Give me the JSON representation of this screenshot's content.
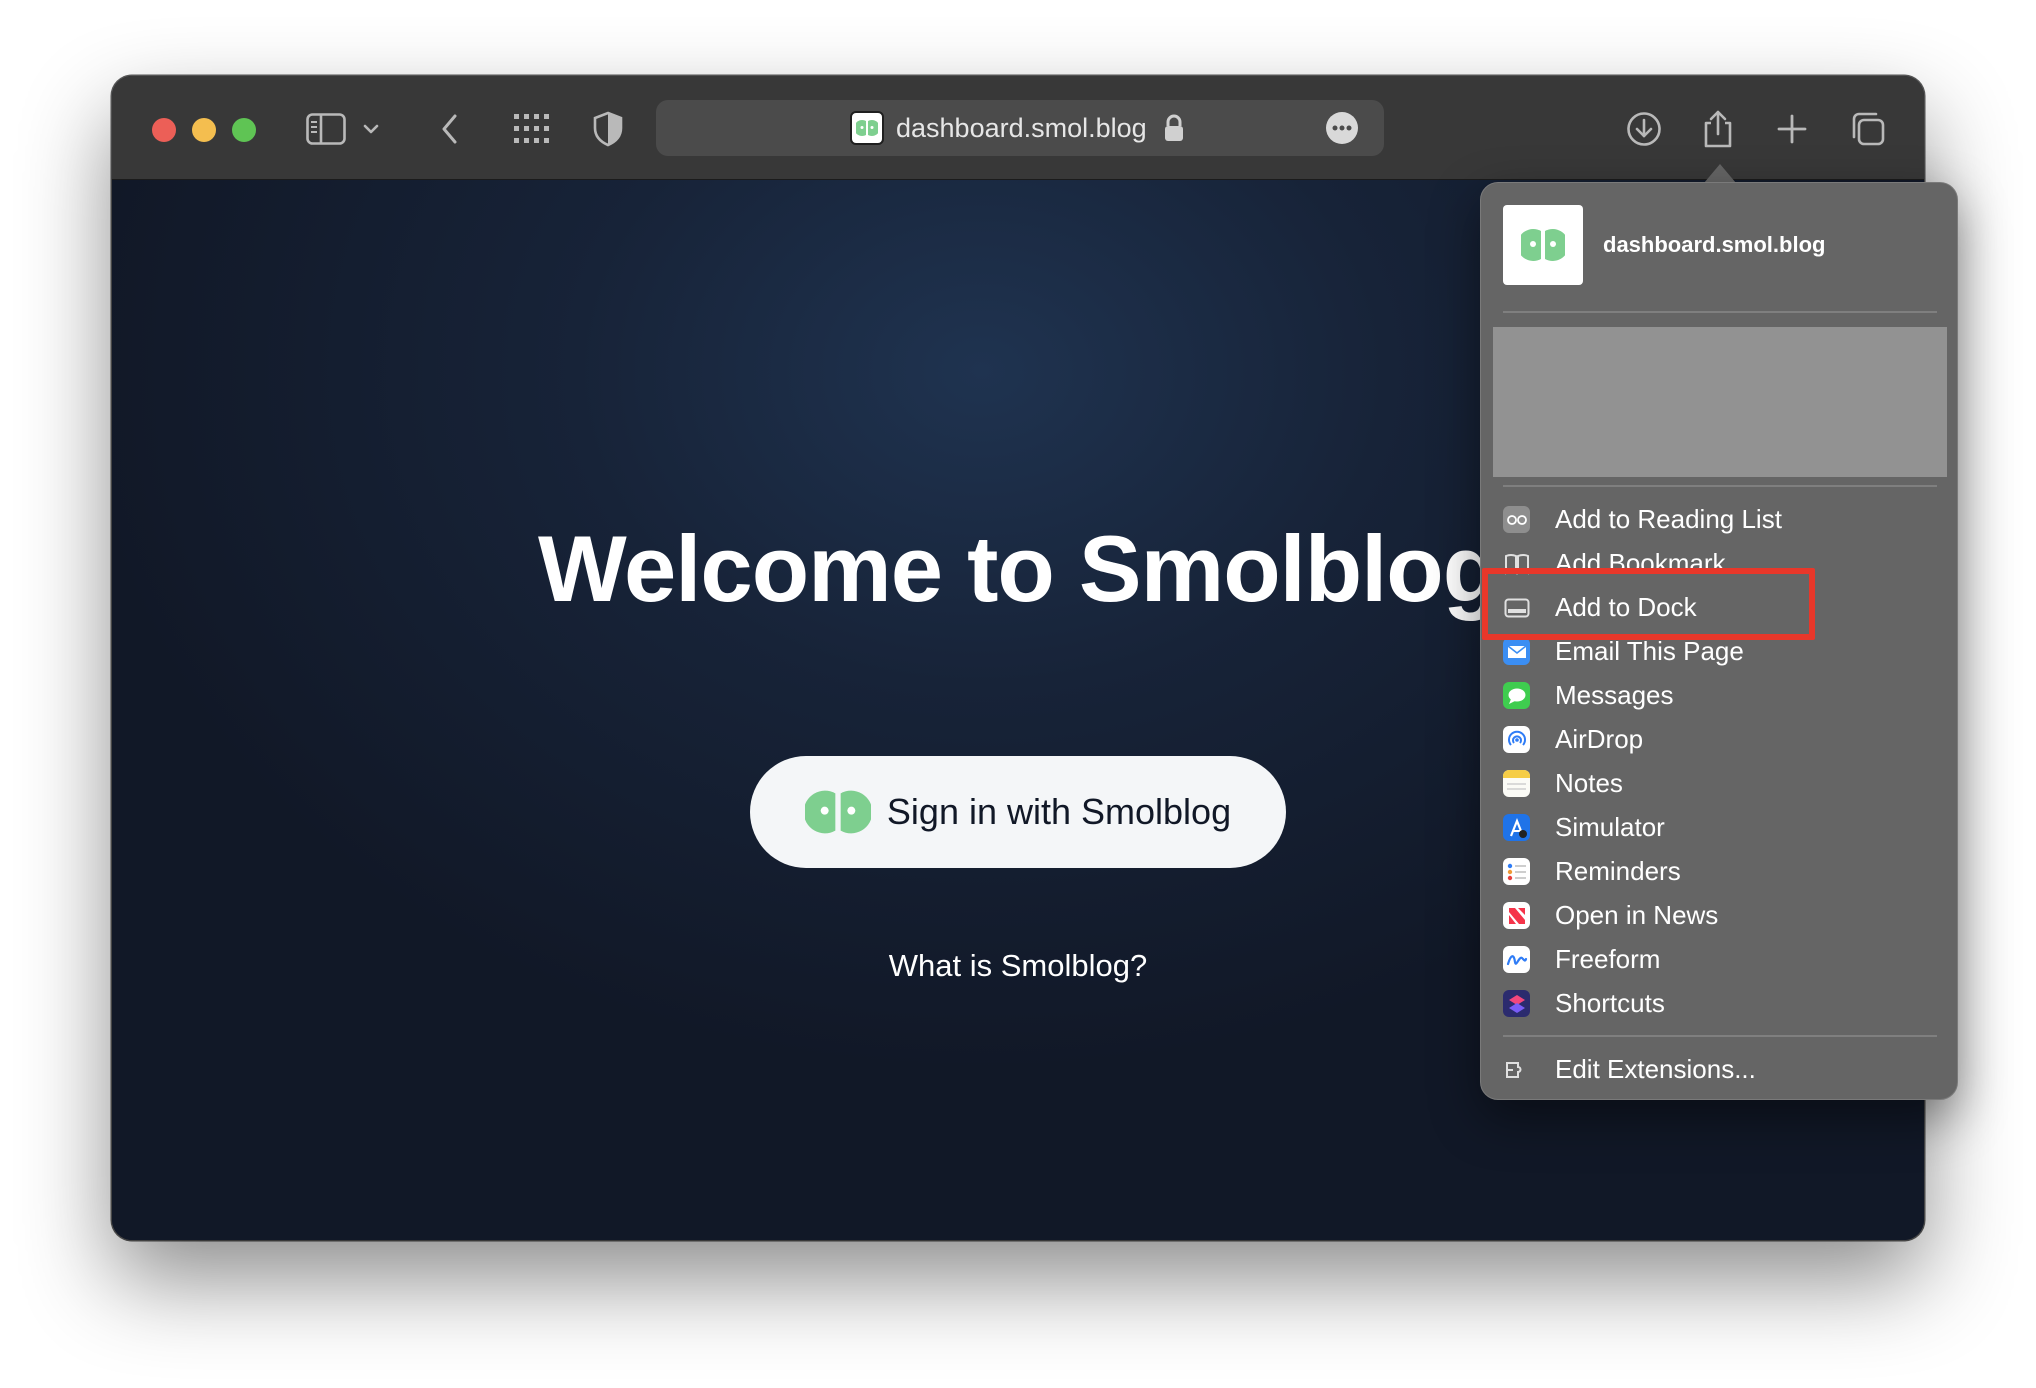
{
  "browser": {
    "url": "dashboard.smol.blog",
    "colors": {
      "close": "#ec5f57",
      "minimize": "#f4be4f",
      "zoom": "#5fc454"
    }
  },
  "page": {
    "title": "Welcome to Smolblog",
    "signin_label": "Sign in with Smolblog",
    "what_label": "What is Smolblog?",
    "accent": "#7ecf8f"
  },
  "share_menu": {
    "site": "dashboard.smol.blog",
    "items": [
      {
        "label": "Add to Reading List",
        "icon": "reading-list-icon"
      },
      {
        "label": "Add Bookmark",
        "icon": "bookmark-icon"
      },
      {
        "label": "Add to Dock",
        "icon": "dock-icon"
      },
      {
        "label": "Email This Page",
        "icon": "mail-icon"
      },
      {
        "label": "Messages",
        "icon": "messages-icon"
      },
      {
        "label": "AirDrop",
        "icon": "airdrop-icon"
      },
      {
        "label": "Notes",
        "icon": "notes-icon"
      },
      {
        "label": "Simulator",
        "icon": "simulator-icon"
      },
      {
        "label": "Reminders",
        "icon": "reminders-icon"
      },
      {
        "label": "Open in News",
        "icon": "news-icon"
      },
      {
        "label": "Freeform",
        "icon": "freeform-icon"
      },
      {
        "label": "Shortcuts",
        "icon": "shortcuts-icon"
      }
    ],
    "edit_label": "Edit Extensions...",
    "highlight_color": "#e8372a"
  }
}
